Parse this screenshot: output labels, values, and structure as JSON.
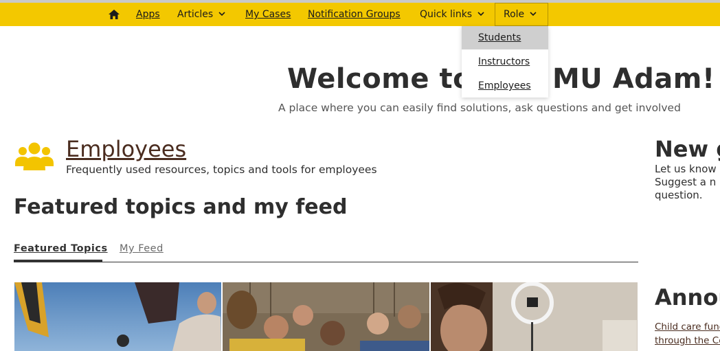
{
  "nav": {
    "home_icon": "home-icon",
    "apps": "Apps",
    "articles": "Articles",
    "my_cases": "My Cases",
    "notification_groups": "Notification Groups",
    "quick_links": "Quick links",
    "role": "Role"
  },
  "role_menu": {
    "items": [
      "Students",
      "Instructors",
      "Employees"
    ],
    "active_index": 0
  },
  "hero": {
    "title_left": "Welcome to",
    "title_right": "MU Adam!",
    "subtitle": "A place where you can easily find solutions, ask questions and get involved"
  },
  "section": {
    "icon": "people-group-icon",
    "title": "Employees",
    "subtitle": "Frequently used resources, topics and tools for employees"
  },
  "featured": {
    "title": "Featured topics and my feed",
    "tabs": [
      "Featured Topics",
      "My Feed"
    ],
    "active_tab": 0
  },
  "right": {
    "heading1": "New g",
    "text_lines": [
      "Let us know",
      "Suggest a n",
      "question."
    ],
    "heading2": "Annou",
    "links": [
      "Child care fund",
      "through the Co"
    ]
  },
  "colors": {
    "nav_bg": "#f3c800",
    "brand_brown": "#4a2c1f",
    "icon_yellow": "#f3c400"
  }
}
